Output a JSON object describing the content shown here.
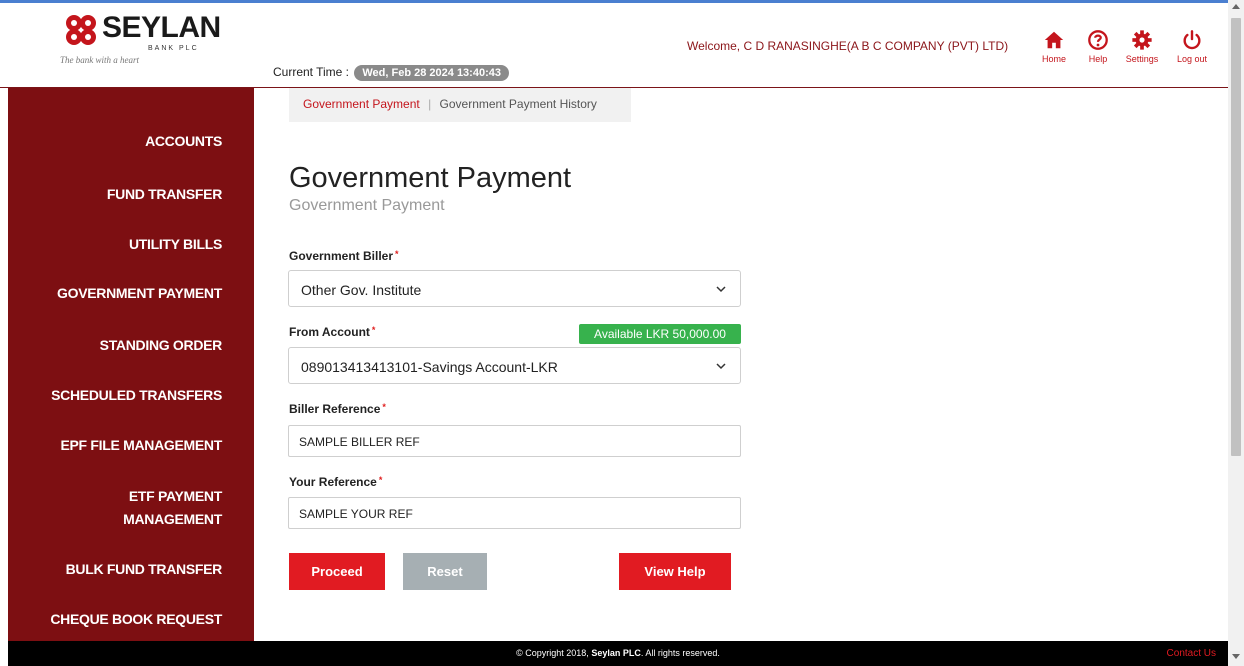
{
  "brand": {
    "name": "SEYLAN",
    "sub": "BANK PLC",
    "tagline": "The bank with a heart"
  },
  "header": {
    "current_time_label": "Current Time :",
    "current_time_value": "Wed, Feb 28 2024 13:40:43",
    "welcome": "Welcome, C D RANASINGHE(A B C COMPANY (PVT) LTD)",
    "nav": {
      "home": "Home",
      "help": "Help",
      "settings": "Settings",
      "logout": "Log out"
    }
  },
  "sidebar": {
    "items": [
      [
        "ACCOUNTS"
      ],
      [
        "FUND TRANSFER"
      ],
      [
        "UTILITY BILLS"
      ],
      [
        "GOVERNMENT PAYMENT"
      ],
      [
        "STANDING ORDER"
      ],
      [
        "SCHEDULED TRANSFERS"
      ],
      [
        "EPF FILE MANAGEMENT"
      ],
      [
        "ETF PAYMENT",
        "MANAGEMENT"
      ],
      [
        "BULK FUND TRANSFER"
      ],
      [
        "CHEQUE BOOK REQUEST"
      ]
    ]
  },
  "breadcrumb": {
    "item1": "Government Payment",
    "separator": "|",
    "item2": "Government Payment History"
  },
  "main": {
    "title": "Government Payment",
    "subtitle": "Government Payment"
  },
  "form": {
    "required_mark": "*",
    "government_biller": {
      "label": "Government Biller",
      "value": "Other Gov. Institute"
    },
    "from_account": {
      "label": "From Account",
      "value": "089013413413101-Savings Account-LKR",
      "available": "Available LKR 50,000.00"
    },
    "biller_reference": {
      "label": "Biller Reference",
      "value": "SAMPLE BILLER REF"
    },
    "your_reference": {
      "label": "Your Reference",
      "value": "SAMPLE YOUR REF"
    },
    "buttons": {
      "proceed": "Proceed",
      "reset": "Reset",
      "view_help": "View Help"
    }
  },
  "footer": {
    "copyright_prefix": "© Copyright 2018,",
    "company": "Seylan PLC",
    "copyright_suffix": ". All rights reserved.",
    "contact": "Contact Us"
  },
  "colors": {
    "brand_red": "#e11b22",
    "sidebar_bg": "#7d0f12",
    "available_green": "#37b24d"
  }
}
